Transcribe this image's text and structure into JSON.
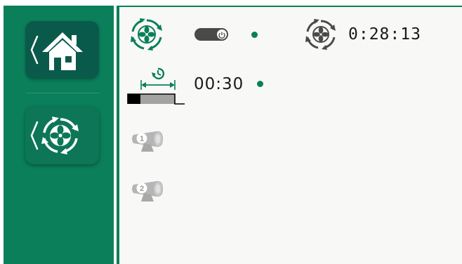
{
  "sidebar": {
    "items": [
      {
        "name": "home",
        "icon": "home-icon",
        "selected": true
      },
      {
        "name": "ventilation",
        "icon": "fan-cycle-icon",
        "selected": false
      }
    ]
  },
  "main": {
    "fan_mode": {
      "icon": "fan-cycle-icon",
      "toggle_state": "on"
    },
    "fan_timer": {
      "icon": "fan-gray-icon",
      "value": "0:28:13"
    },
    "delay": {
      "icon": "delay-timer-icon",
      "value": "00:30"
    },
    "sensors": [
      {
        "icon": "sensor-1-icon",
        "number": "1"
      },
      {
        "icon": "sensor-2-icon",
        "number": "2"
      }
    ]
  },
  "colors": {
    "accent": "#0a7f59",
    "active_nav": "#0a5a4b",
    "background": "#f8f8f7",
    "toggle": "#4a4a4a",
    "inactive_icon": "#b5b5b5"
  }
}
